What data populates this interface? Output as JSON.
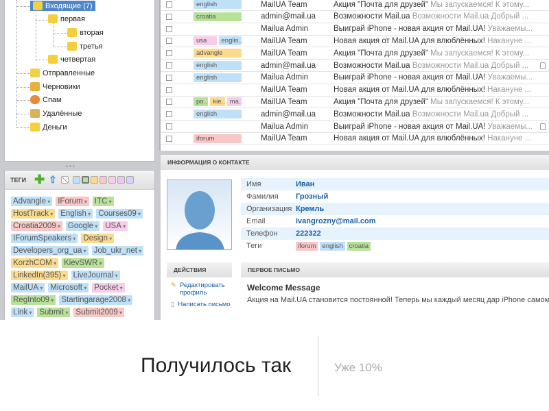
{
  "folders": {
    "inbox": "Входящие (7)",
    "f1": "первая",
    "f2": "вторая",
    "f3": "третья",
    "f4": "четвертая",
    "sent": "Отправленные",
    "drafts": "Черновики",
    "spam": "Спам",
    "deleted": "Удалённые",
    "money": "Деньги"
  },
  "tags_panel": {
    "title": "ТЕГИ",
    "swatches": [
      "#bfe0f7",
      "#b8e29a",
      "#fbdc8e",
      "#f9c7c7",
      "#f7cdea",
      "#e8c9f3",
      "#d9d3f7"
    ],
    "tags": [
      {
        "t": "Advangle",
        "c": "#bfe0f7"
      },
      {
        "t": "IForum",
        "c": "#f9c7c7"
      },
      {
        "t": "ITC",
        "c": "#b8e29a"
      },
      {
        "t": "HostTrack",
        "c": "#fbdc8e"
      },
      {
        "t": "English",
        "c": "#bfe0f7"
      },
      {
        "t": "Courses09",
        "c": "#bfe0f7"
      },
      {
        "t": "Croatia2009",
        "c": "#f9c7c7"
      },
      {
        "t": "Google",
        "c": "#bfe0f7"
      },
      {
        "t": "USA",
        "c": "#f7cdea"
      },
      {
        "t": "IForumSpeakers",
        "c": "#bfe0f7"
      },
      {
        "t": "Design",
        "c": "#fbdc8e"
      },
      {
        "t": "Developers_org_ua",
        "c": "#bfe0f7"
      },
      {
        "t": "Job_ukr_net",
        "c": "#bfe0f7"
      },
      {
        "t": "KorzhCOM",
        "c": "#fbdc8e"
      },
      {
        "t": "KievSWR",
        "c": "#b8e29a"
      },
      {
        "t": "LinkedIn(395)",
        "c": "#fbdc8e"
      },
      {
        "t": "LiveJournal",
        "c": "#bfe0f7"
      },
      {
        "t": "MailUA",
        "c": "#bfe0f7"
      },
      {
        "t": "Microsoft",
        "c": "#bfe0f7"
      },
      {
        "t": "Pocket",
        "c": "#f7cdea"
      },
      {
        "t": "RegInto09",
        "c": "#b8e29a"
      },
      {
        "t": "Startingarage2008",
        "c": "#bfe0f7"
      },
      {
        "t": "Link",
        "c": "#bfe0f7"
      },
      {
        "t": "Submit",
        "c": "#b8e29a"
      },
      {
        "t": "Submit2009",
        "c": "#f9c7c7"
      }
    ]
  },
  "mails": [
    {
      "tags": [
        {
          "t": "english",
          "c": "#bfe0f7"
        }
      ],
      "from": "MailUA Team",
      "subj": "Акция \"Почта для друзей\"",
      "prev": "Мы запускаемся! К этому...",
      "att": false
    },
    {
      "tags": [
        {
          "t": "croatia",
          "c": "#b8e29a"
        }
      ],
      "from": "admin@mail.ua",
      "subj": "Возможности Mail.ua",
      "prev": "Возможности Mail.ua Добрый ...",
      "att": false
    },
    {
      "tags": [],
      "from": "Mailua Admin",
      "subj": "Выиграй iPhone - новая акция от Mail.UA!",
      "prev": "Уважаемы...",
      "att": false
    },
    {
      "tags": [
        {
          "t": "usa",
          "c": "#f7cdea"
        },
        {
          "t": "englis..",
          "c": "#bfe0f7"
        }
      ],
      "from": "MailUA Team",
      "subj": "Новая акция от Mail.UA для влюблённых!",
      "prev": "Накануне ...",
      "att": false
    },
    {
      "tags": [
        {
          "t": "advangle",
          "c": "#fbdc8e"
        }
      ],
      "from": "MailUA Team",
      "subj": "Акция \"Почта для друзей\"",
      "prev": "Мы запускаемся! К этому...",
      "att": false
    },
    {
      "tags": [
        {
          "t": "english",
          "c": "#bfe0f7"
        }
      ],
      "from": "admin@mail.ua",
      "subj": "Возможности Mail.ua",
      "prev": "Возможности Mail.ua Добрый ...",
      "att": true
    },
    {
      "tags": [
        {
          "t": "english",
          "c": "#bfe0f7"
        }
      ],
      "from": "Mailua Admin",
      "subj": "Выиграй iPhone - новая акция от Mail.UA!",
      "prev": "Уважаемы...",
      "att": false
    },
    {
      "tags": [],
      "from": "MailUA Team",
      "subj": "Новая акция от Mail.UA для влюблённых!",
      "prev": "Накануне ...",
      "att": false
    },
    {
      "tags": [
        {
          "t": "po..",
          "c": "#b8e29a"
        },
        {
          "t": "kie..",
          "c": "#fbdc8e"
        },
        {
          "t": "ma..",
          "c": "#f7cdea"
        }
      ],
      "from": "MailUA Team",
      "subj": "Акция \"Почта для друзей\"",
      "prev": "Мы запускаемся! К этому...",
      "att": false
    },
    {
      "tags": [
        {
          "t": "english",
          "c": "#bfe0f7"
        }
      ],
      "from": "admin@mail.ua",
      "subj": "Возможности Mail.ua",
      "prev": "Возможности Mail.ua Добрый ...",
      "att": false
    },
    {
      "tags": [],
      "from": "Mailua Admin",
      "subj": "Выиграй iPhone - новая акция от Mail.UA!",
      "prev": "Уважаемы...",
      "att": true
    },
    {
      "tags": [
        {
          "t": "iforum",
          "c": "#f9c7c7"
        }
      ],
      "from": "MailUA Team",
      "subj": "Новая акция от Mail.UA для влюблённых!",
      "prev": "Накануне ...",
      "att": false
    }
  ],
  "contact": {
    "title": "ИНФОРМАЦИЯ О КОНТАКТЕ",
    "fields": [
      {
        "l": "Имя",
        "v": "Иван"
      },
      {
        "l": "Фамилия",
        "v": "Грозный"
      },
      {
        "l": "Организация",
        "v": "Кремль"
      },
      {
        "l": "Email",
        "v": "ivangrozny@mail.com"
      },
      {
        "l": "Телефон",
        "v": "222322"
      }
    ],
    "tags_label": "Теги",
    "tags": [
      {
        "t": "iforum",
        "c": "#f9c7c7"
      },
      {
        "t": "english",
        "c": "#bfe0f7"
      },
      {
        "t": "croatia",
        "c": "#b8e29a"
      }
    ]
  },
  "actions": {
    "title": "ДЕЙСТВИЯ",
    "edit": "Редактировать профиль",
    "write": "Написать письмо"
  },
  "first_letter": {
    "title": "ПЕРВОЕ ПИСЬМО",
    "subject": "Welcome Message",
    "body": "Акция на Mail.UA становится постоянной! Теперь мы каждый месяц дар iPhone самому преданному пользователю..."
  },
  "slide": {
    "title": "Получилось так",
    "subtitle": "Уже 10%"
  }
}
